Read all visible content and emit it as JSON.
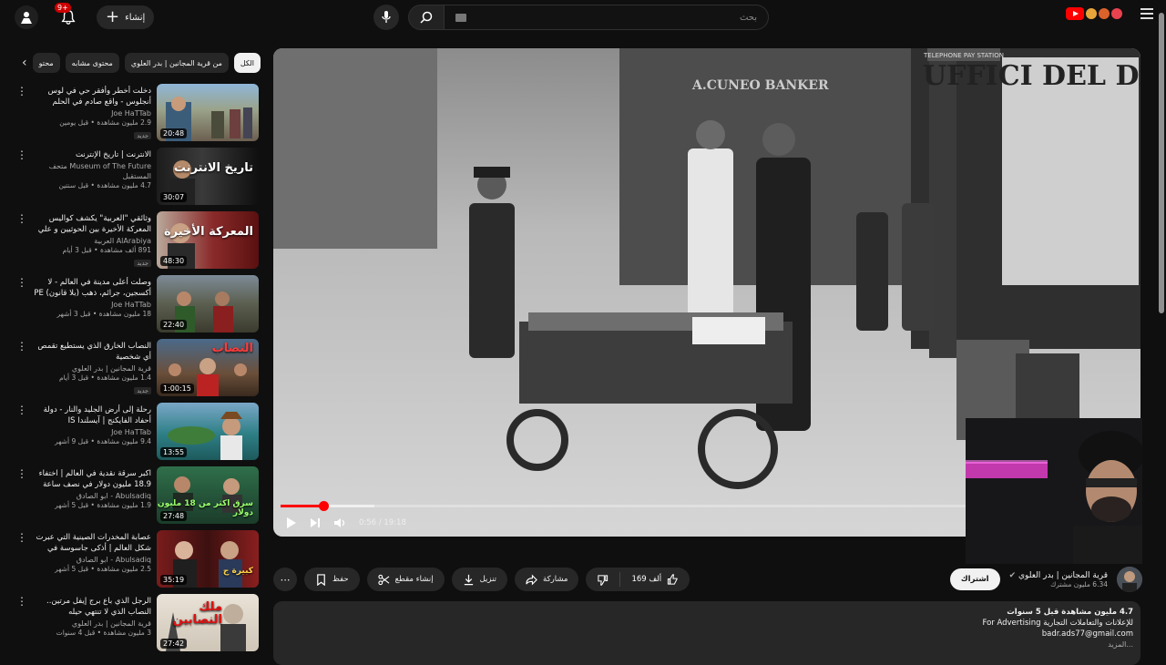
{
  "topbar": {
    "create_label": "إنشاء",
    "notif_count": "9+",
    "search_placeholder": "بحث"
  },
  "chips": [
    {
      "label": "الكل",
      "active": true
    },
    {
      "label": "من قرية المجانين | بدر العلوي",
      "active": false
    },
    {
      "label": "محتوى مشابه",
      "active": false
    },
    {
      "label": "محتو",
      "active": false
    }
  ],
  "list": [
    {
      "title": "دخلت أخطر وأفقر حي في لوس أنجلوس - واقع صادم في الحلم الأمريكي US",
      "channel": "Joe HaTTab",
      "stats": "2.9 مليون مشاهدة • قبل يومين",
      "badge": "جديد",
      "duration": "20:48",
      "thumb_text": ""
    },
    {
      "title": "الانترنت | تاريخ الإنترنت",
      "channel": "Museum of The Future متحف المستقبل",
      "stats": "4.7 مليون مشاهدة • قبل سنتين",
      "badge": "",
      "duration": "30:07",
      "thumb_text": "تاريخ الانترنت"
    },
    {
      "title": "وثائقي \"العربية\" يكشف كواليس المعركة الأخيرة بين الحوثيين و علي عبد الله صالح",
      "channel": "AlArabiya العربية",
      "stats": "891 ألف مشاهدة • قبل 3 أيام",
      "badge": "جديد",
      "duration": "48:30",
      "thumb_text": "المعركة الأخيرة"
    },
    {
      "title": "وصلت أعلى مدينة في العالم - لا أكسجين، جرائم، ذهب (بلا قانون) PE",
      "channel": "Joe HaTTab",
      "stats": "18 مليون مشاهدة • قبل 3 أشهر",
      "badge": "",
      "duration": "22:40",
      "thumb_text": ""
    },
    {
      "title": "النصاب الخارق الذي يستطيع تقمص أي شخصية",
      "channel": "قرية المجانين | بدر العلوي",
      "stats": "1.4 مليون مشاهدة • قبل 3 أيام",
      "badge": "جديد",
      "duration": "1:00:15",
      "thumb_text": "النصاب"
    },
    {
      "title": "رحلة إلى أرض الجليد والنار - دولة أحفاد الفايكنج | آيسلندا IS",
      "channel": "Joe HaTTab",
      "stats": "9.4 مليون مشاهدة • قبل 9 أشهر",
      "badge": "",
      "duration": "13:55",
      "thumb_text": ""
    },
    {
      "title": "اكبر سرقة نقدية في العالم | اختفاء 18.9 مليون دولار في نصف ساعة",
      "channel": "Abulsadiq - ابو الصادق",
      "stats": "1.9 مليون مشاهدة • قبل 5 أشهر",
      "badge": "",
      "duration": "27:48",
      "thumb_text": "سرق اكثر من 18 مليون دولار"
    },
    {
      "title": "عصابة المخدرات الصينية التي عبرت شكل العالم | أذكى جاسوسة في التاريخ",
      "channel": "Abulsadiq - ابو الصادق",
      "stats": "2.5 مليون مشاهدة • قبل 5 أشهر",
      "badge": "",
      "duration": "35:19",
      "thumb_text": "كبيرة ج"
    },
    {
      "title": "الرجل الذي باع برج إيفل مرتين.. النصاب الذي لا تنتهي حيله",
      "channel": "قرية المجانين | بدر العلوي",
      "stats": "3 مليون مشاهدة • قبل 4 سنوات",
      "badge": "",
      "duration": "27:42",
      "thumb_text": "ملك النصابين"
    }
  ],
  "player": {
    "time": "0:56 / 19:18",
    "progress_played": 0.05,
    "progress_buffered": 0.11,
    "sign_left": "A.CUNEO BANKER",
    "sign_right": "UFFICI DEL Dr. P. FE",
    "sign_top": "TELEPHONE PAY STATION"
  },
  "actions": {
    "likes": "169 ألف",
    "share": "مشاركة",
    "download": "تنزيل",
    "clip": "إنشاء مقطع",
    "save": "حفظ"
  },
  "channel": {
    "name": "قرية المجانين | بدر العلوي",
    "subs": "6.34 مليون مشترك",
    "subscribe": "اشتراك"
  },
  "description": {
    "stats": "4.7 مليون مشاهدة  قبل 5 سنوات",
    "line2": "للإعلانات والتعاملات التجارية For Advertising",
    "email": "badr.ads77@gmail.com",
    "more": "...المزيد"
  }
}
